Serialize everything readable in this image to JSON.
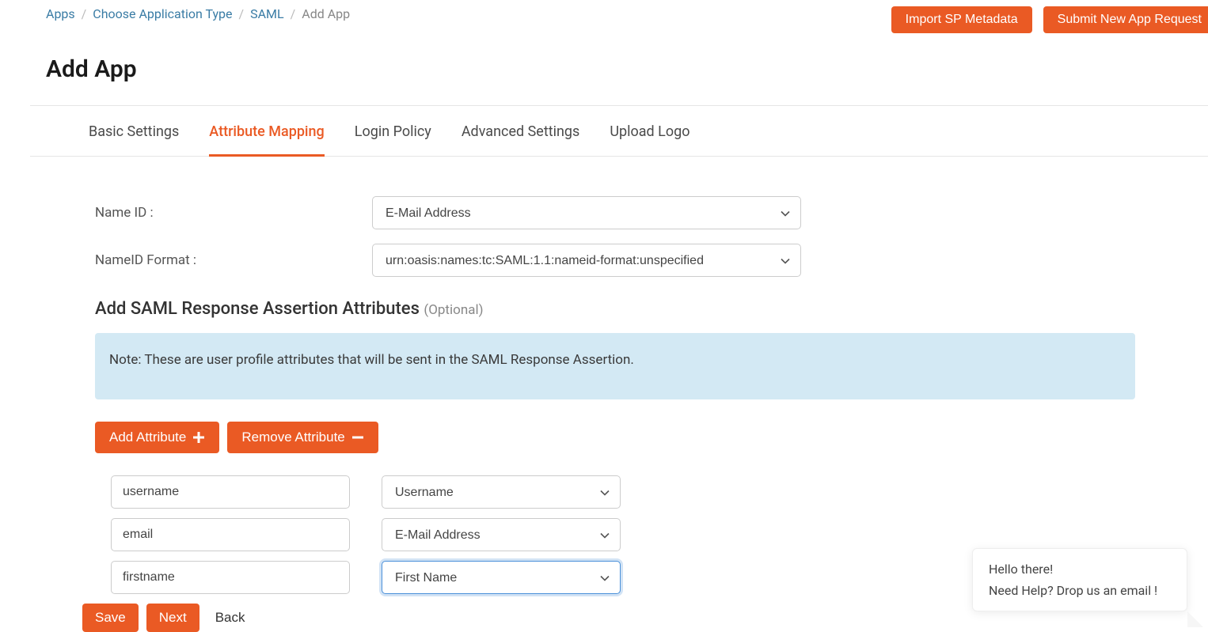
{
  "breadcrumb": {
    "items": [
      "Apps",
      "Choose Application Type",
      "SAML"
    ],
    "current": "Add App"
  },
  "topButtons": {
    "import": "Import SP Metadata",
    "submit": "Submit New App Request"
  },
  "pageTitle": "Add App",
  "tabs": [
    "Basic Settings",
    "Attribute Mapping",
    "Login Policy",
    "Advanced Settings",
    "Upload Logo"
  ],
  "activeTab": 1,
  "form": {
    "nameIdLabel": "Name ID :",
    "nameIdValue": "E-Mail Address",
    "nameIdFormatLabel": "NameID Format :",
    "nameIdFormatValue": "urn:oasis:names:tc:SAML:1.1:nameid-format:unspecified"
  },
  "sectionHeading": "Add SAML Response Assertion Attributes",
  "sectionOptional": "(Optional)",
  "noteText": "Note: These are user profile attributes that will be sent in the SAML Response Assertion.",
  "attrButtons": {
    "add": "Add Attribute",
    "remove": "Remove Attribute"
  },
  "attributeRows": [
    {
      "key": "username",
      "value": "Username"
    },
    {
      "key": "email",
      "value": "E-Mail Address"
    },
    {
      "key": "firstname",
      "value": "First Name"
    }
  ],
  "footerButtons": {
    "save": "Save",
    "next": "Next",
    "back": "Back"
  },
  "help": {
    "line1": "Hello there!",
    "line2": "Need Help? Drop us an email !"
  },
  "colors": {
    "accent": "#ea5a24",
    "link": "#3a7ca5",
    "noteBg": "#d3e9f4"
  }
}
